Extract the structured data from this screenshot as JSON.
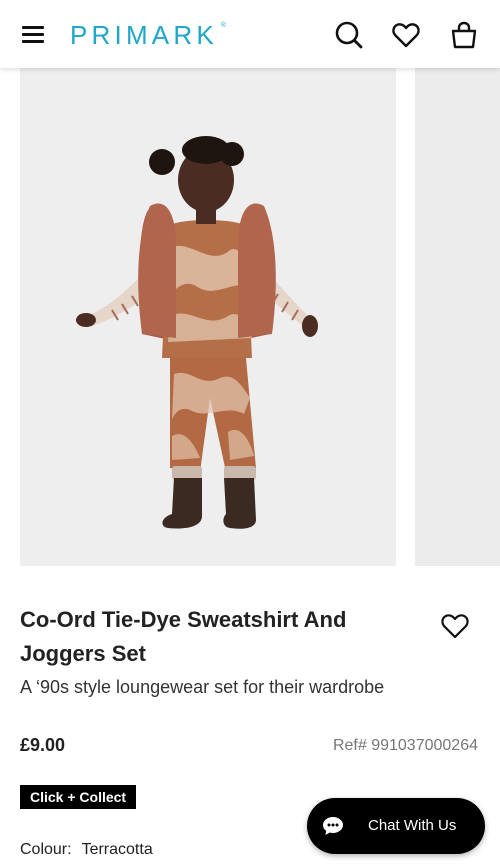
{
  "header": {
    "brand": "PRIMARK",
    "trademark": "®"
  },
  "product": {
    "title": "Co-Ord Tie-Dye Sweatshirt And Joggers Set",
    "subtitle": "A ‘90s style loungewear set for their wardrobe",
    "price": "£9.00",
    "ref": "Ref# 991037000264",
    "badge": "Click + Collect",
    "colour_label": "Colour:",
    "colour_value": "Terracotta"
  },
  "chat": {
    "label": "Chat With Us"
  },
  "colors": {
    "brand": "#1fa7c9",
    "badge_bg": "#000000",
    "chat_bg": "#000000"
  }
}
